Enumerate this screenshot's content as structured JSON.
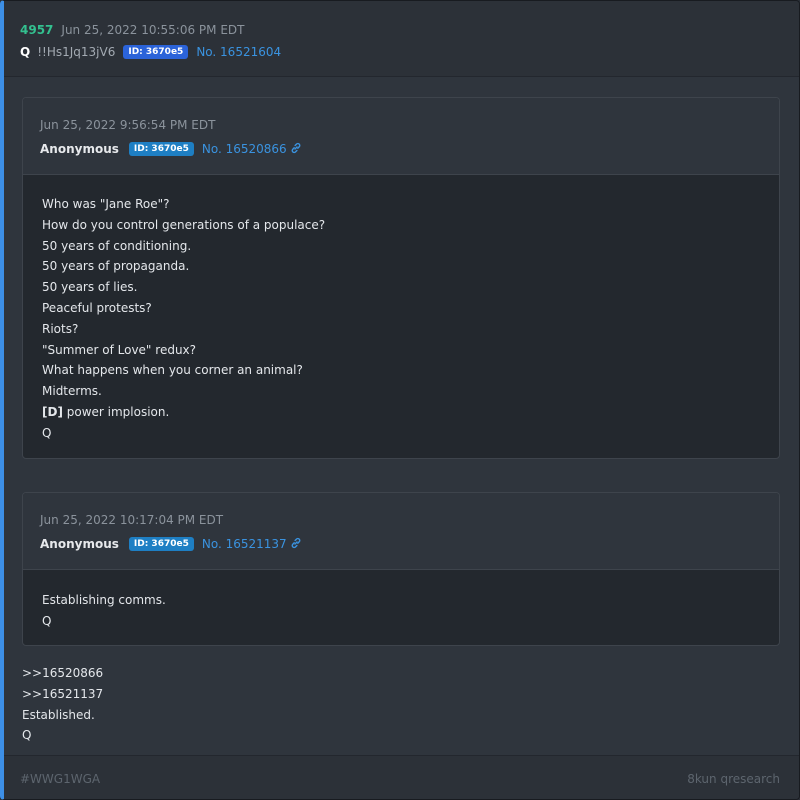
{
  "post": {
    "number": "4957",
    "date": "Jun 25, 2022 10:55:06 PM EDT",
    "author": "Q",
    "tripcode": "!!Hs1Jq13jV6",
    "id_badge": "ID: 3670e5",
    "post_no": "No. 16521604"
  },
  "quotes": [
    {
      "date": "Jun 25, 2022 9:56:54 PM EDT",
      "author": "Anonymous",
      "id_badge": "ID: 3670e5",
      "post_no": "No. 16520866",
      "lines": [
        "Who was \"Jane Roe\"?",
        "How do you control generations of a populace?",
        "50 years of conditioning.",
        "50 years of propaganda.",
        "50 years of lies.",
        "Peaceful protests?",
        "Riots?",
        "\"Summer of Love\" redux?",
        "What happens when you corner an animal?",
        "Midterms."
      ],
      "bold_prefix": "[D]",
      "bold_rest": " power implosion.",
      "sign": "Q"
    },
    {
      "date": "Jun 25, 2022 10:17:04 PM EDT",
      "author": "Anonymous",
      "id_badge": "ID: 3670e5",
      "post_no": "No. 16521137",
      "lines": [
        "Establishing comms.",
        "Q"
      ]
    }
  ],
  "reply": {
    "lines": [
      ">>16520866",
      ">>16521137",
      "Established.",
      "Q"
    ]
  },
  "footer": {
    "hashtag": "#WWG1WGA",
    "source": "8kun qresearch"
  },
  "colors": {
    "accent": "#3d8fe6",
    "post_number": "#33c08f",
    "link": "#3a93e0",
    "badge_blue": "#2b63d9",
    "badge_cyan": "#1e7fc4"
  },
  "icons": {
    "link": "chain-link-icon"
  }
}
